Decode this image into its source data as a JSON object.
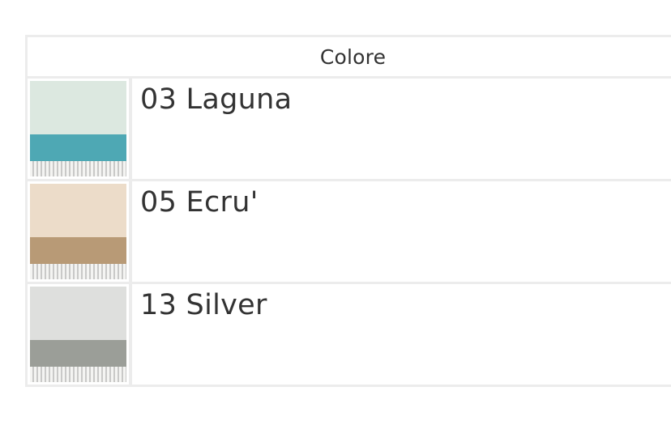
{
  "table": {
    "header": "Colore",
    "rows": [
      {
        "label": "03 Laguna",
        "swatch": {
          "icon": "scarf-swatch-laguna",
          "top_color": "#dce8e0",
          "band_color": "#4ea8b4"
        }
      },
      {
        "label": "05 Ecru'",
        "swatch": {
          "icon": "scarf-swatch-ecru",
          "top_color": "#ecdcc9",
          "band_color": "#b89a76"
        }
      },
      {
        "label": "13 Silver",
        "swatch": {
          "icon": "scarf-swatch-silver",
          "top_color": "#dedfdd",
          "band_color": "#9b9e98"
        }
      }
    ]
  }
}
